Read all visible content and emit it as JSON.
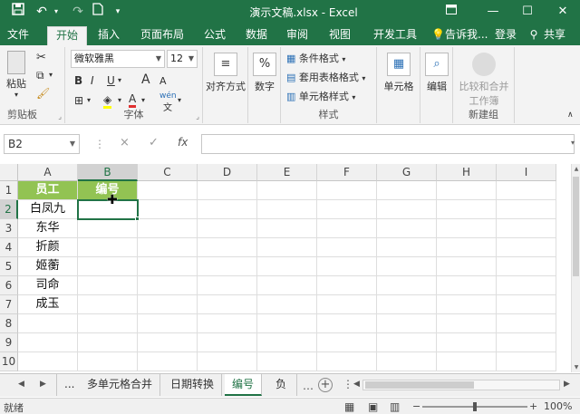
{
  "titlebar": {
    "document_title": "演示文稿.xlsx - Excel",
    "save_icon": "save-icon",
    "undo_icon": "undo-icon",
    "redo_icon": "redo-icon",
    "newdoc_icon": "new-document-icon",
    "customize_icon": "dropdown-icon",
    "ribbon_display_icon": "ribbon-display-icon",
    "minimize_icon": "minimize-icon",
    "maximize_icon": "maximize-icon",
    "close_icon": "close-icon",
    "brand_color": "#217346"
  },
  "menu": {
    "tabs": [
      "文件",
      "开始",
      "插入",
      "页面布局",
      "公式",
      "数据",
      "审阅",
      "视图",
      "开发工具"
    ],
    "active_tab": "开始",
    "tell_me": "告诉我...",
    "login": "登录",
    "share": "共享"
  },
  "ribbon": {
    "clipboard": {
      "label": "剪贴板",
      "paste": "粘贴"
    },
    "font": {
      "label": "字体",
      "font_name": "微软雅黑",
      "font_size": "12",
      "bold": "B",
      "italic": "I",
      "underline": "U",
      "grow": "A",
      "shrink": "A",
      "font_color": "A",
      "phonetic": "wén"
    },
    "alignment": {
      "label": "对齐方式"
    },
    "number": {
      "label": "数字",
      "symbol": "%"
    },
    "styles": {
      "label": "样式",
      "conditional": "条件格式",
      "table_format": "套用表格格式",
      "cell_styles": "单元格样式"
    },
    "cells": {
      "label": "单元格"
    },
    "editing": {
      "label": "编辑"
    },
    "newgroup": {
      "label": "新建组",
      "compare_merge": "比较和合并",
      "workbook": "工作簿"
    }
  },
  "formula_bar": {
    "name_box": "B2",
    "cancel": "×",
    "enter": "✓",
    "fx": "fx",
    "formula": ""
  },
  "grid": {
    "columns": [
      "A",
      "B",
      "C",
      "D",
      "E",
      "F",
      "G",
      "H",
      "I"
    ],
    "selected_column": "B",
    "rows": [
      "1",
      "2",
      "3",
      "4",
      "5",
      "6",
      "7",
      "8",
      "9",
      "10"
    ],
    "selected_row": "2",
    "header_fill": "#92c353",
    "cells": {
      "A1": "员工",
      "B1": "编号",
      "A2": "白凤九",
      "A3": "东华",
      "A4": "折颜",
      "A5": "姬蘅",
      "A6": "司命",
      "A7": "成玉"
    }
  },
  "sheets": {
    "more": "...",
    "tabs": [
      "多单元格合并",
      "日期转换",
      "编号",
      "负数"
    ],
    "active": "编号"
  },
  "status": {
    "mode": "就绪",
    "zoom": "100%",
    "minus": "−",
    "plus": "+"
  }
}
